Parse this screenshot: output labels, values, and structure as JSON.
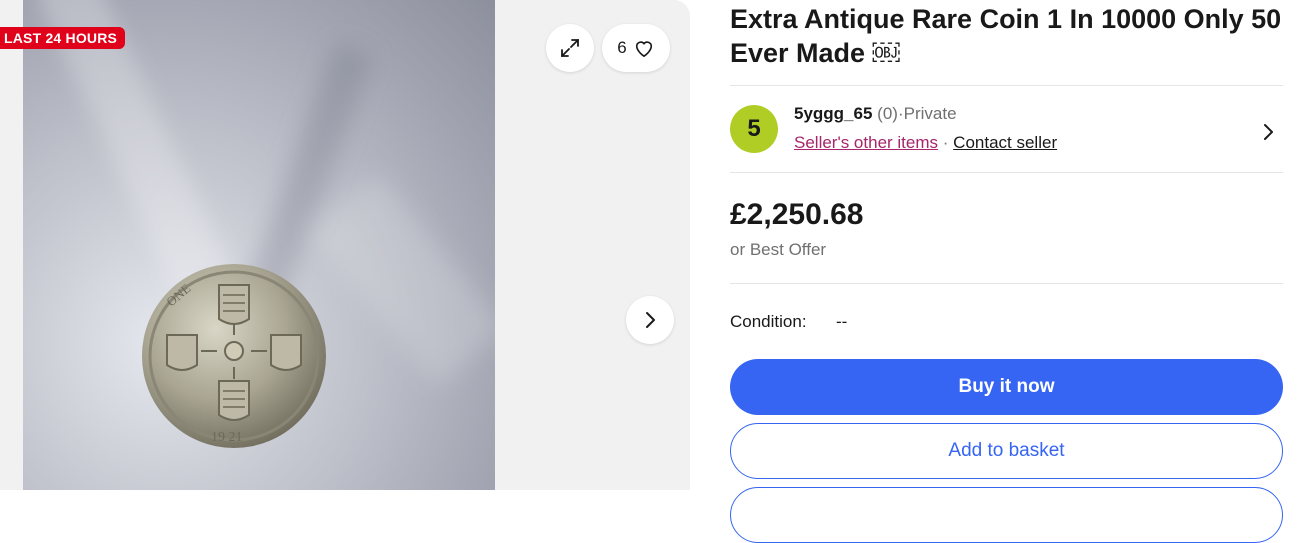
{
  "gallery": {
    "badge": "LAST 24 HOURS",
    "watch_count": "6",
    "icons": {
      "expand": "expand-icon",
      "heart": "heart-icon",
      "next": "chevron-right-icon"
    }
  },
  "listing": {
    "title": "Extra Antique Rare Coin 1 In 10000 Only 50 Ever Made ￼"
  },
  "seller": {
    "avatar_letter": "5",
    "avatar_color": "#b0cd26",
    "name": "5yggg_65",
    "feedback": "(0)",
    "separator": "·",
    "type": "Private",
    "other_items": "Seller's other items",
    "contact": "Contact seller"
  },
  "price": {
    "amount": "£2,250.68",
    "offer": "or Best Offer"
  },
  "condition": {
    "label": "Condition:",
    "value": "--"
  },
  "actions": {
    "buy_now": "Buy it now",
    "add_to_basket": "Add to basket"
  },
  "colors": {
    "primary": "#3665f3",
    "badge_red": "#e0021b",
    "seller_link": "#a6256b"
  }
}
